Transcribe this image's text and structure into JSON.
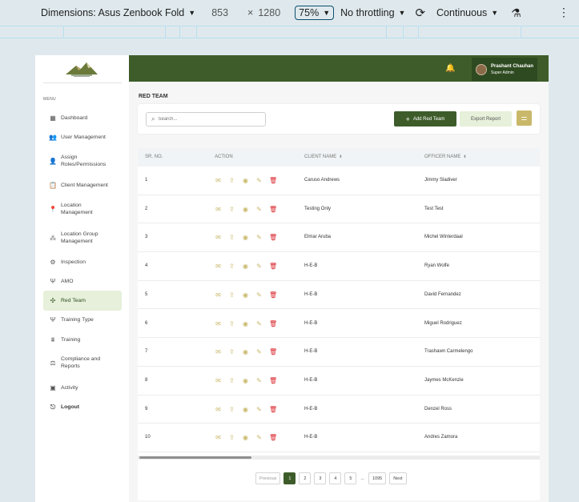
{
  "devtools": {
    "device": "Dimensions: Asus Zenbook Fold",
    "width": "853",
    "times": "×",
    "height": "1280",
    "zoom": "75%",
    "throttle": "No throttling",
    "mode": "Continuous"
  },
  "sidebar": {
    "menu_title": "MENU",
    "items": [
      {
        "label": "Dashboard",
        "icon": "grid-icon"
      },
      {
        "label": "User Management",
        "icon": "users-icon"
      },
      {
        "label": "Assign Roles/Permissions",
        "icon": "roles-icon"
      },
      {
        "label": "Client Management",
        "icon": "clipboard-icon"
      },
      {
        "label": "Location Management",
        "icon": "location-pin-icon"
      },
      {
        "label": "Location Group Management",
        "icon": "location-group-icon"
      },
      {
        "label": "Inspection",
        "icon": "inspection-gear-icon"
      },
      {
        "label": "AMO",
        "icon": "amo-icon"
      },
      {
        "label": "Red Team",
        "icon": "red-team-icon"
      },
      {
        "label": "Training Type",
        "icon": "training-type-icon"
      },
      {
        "label": "Training",
        "icon": "training-icon"
      },
      {
        "label": "Compliance and Reports",
        "icon": "compliance-icon"
      },
      {
        "label": "Activity",
        "icon": "activity-icon"
      },
      {
        "label": "Logout",
        "icon": "logout-icon"
      }
    ]
  },
  "header": {
    "user_name": "Prashant Chauhan",
    "user_role": "Super Admin"
  },
  "page": {
    "title": "RED TEAM",
    "search_placeholder": "Search...",
    "add_label": "Add Red Team",
    "export_label": "Export Report"
  },
  "table": {
    "columns": [
      "SR. NO.",
      "ACTION",
      "CLIENT NAME",
      "OFFICER NAME"
    ],
    "rows": [
      {
        "sr": "1",
        "client": "Caruso Andrews",
        "officer": "Jimmy Sladiver"
      },
      {
        "sr": "2",
        "client": "Testing Only",
        "officer": "Test Test"
      },
      {
        "sr": "3",
        "client": "Elmar Aruba",
        "officer": "Michel Winterdaal"
      },
      {
        "sr": "4",
        "client": "H-E-B",
        "officer": "Ryan Wolfe"
      },
      {
        "sr": "5",
        "client": "H-E-B",
        "officer": "David Fernandez"
      },
      {
        "sr": "6",
        "client": "H-E-B",
        "officer": "Miguel Rodriguez"
      },
      {
        "sr": "7",
        "client": "H-E-B",
        "officer": "Trashawn Carmelengo"
      },
      {
        "sr": "8",
        "client": "H-E-B",
        "officer": "Jaymes McKenzie"
      },
      {
        "sr": "9",
        "client": "H-E-B",
        "officer": "Denzel Ross"
      },
      {
        "sr": "10",
        "client": "H-E-B",
        "officer": "Andres Zamora"
      }
    ]
  },
  "pagination": {
    "previous": "Previous",
    "pages": [
      "1",
      "2",
      "3",
      "4",
      "5"
    ],
    "ellipsis": "...",
    "last": "1095",
    "next": "Next",
    "current": "1"
  },
  "colors": {
    "brand": "#3d5c2a",
    "accent": "#c9b86a",
    "delete": "#d9262c",
    "active_bg": "#e6f0da"
  }
}
